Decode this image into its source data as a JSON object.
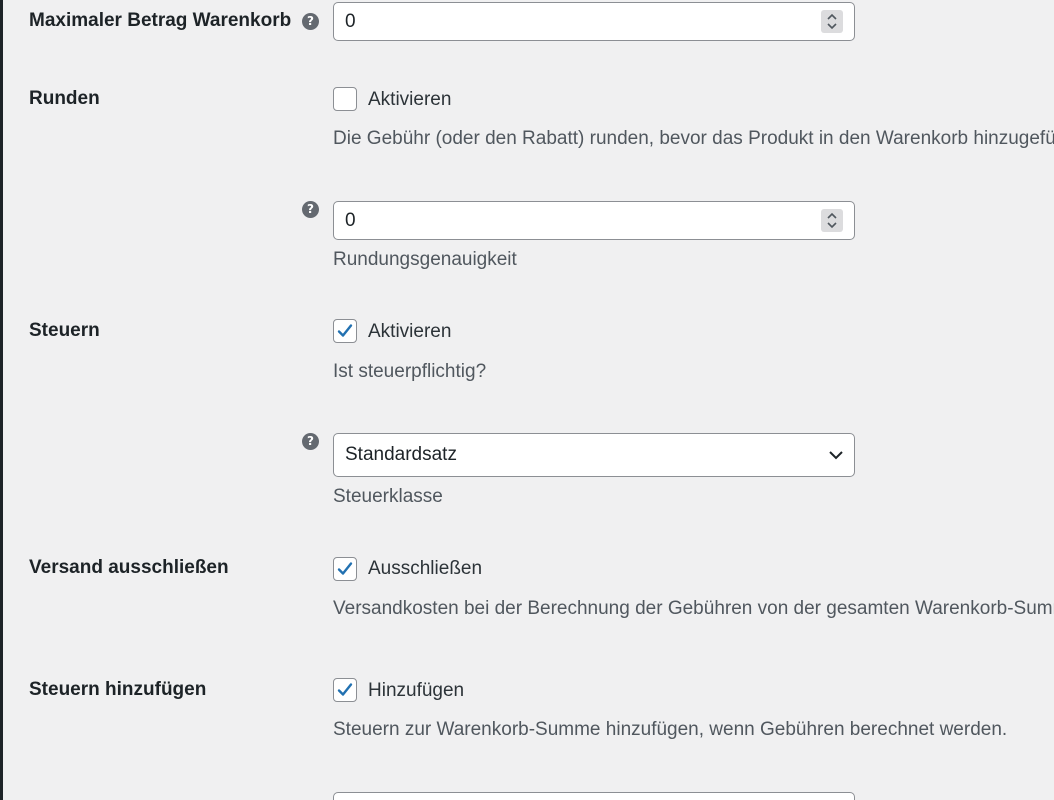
{
  "fields": {
    "max_cart": {
      "label": "Maximaler Betrag Warenkorb",
      "value": "0"
    },
    "round": {
      "label": "Runden",
      "checkbox_label": "Aktivieren",
      "checked": false,
      "description": "Die Gebühr (oder den Rabatt) runden, bevor das Produkt in den Warenkorb hinzugefü"
    },
    "rounding_precision": {
      "value": "0",
      "description": "Rundungsgenauigkeit"
    },
    "taxes": {
      "label": "Steuern",
      "checkbox_label": "Aktivieren",
      "checked": true,
      "description": "Ist steuerpflichtig?"
    },
    "tax_class": {
      "selected": "Standardsatz",
      "description": "Steuerklasse"
    },
    "exclude_shipping": {
      "label": "Versand ausschließen",
      "checkbox_label": "Ausschließen",
      "checked": true,
      "description": "Versandkosten bei der Berechnung der Gebühren von der gesamten Warenkorb-Summ"
    },
    "add_taxes": {
      "label": "Steuern hinzufügen",
      "checkbox_label": "Hinzufügen",
      "checked": true,
      "description": "Steuern zur Warenkorb-Summe hinzufügen, wenn Gebühren berechnet werden."
    }
  },
  "help_icon_glyph": "?",
  "colors": {
    "checkmark": "#2271b1",
    "background": "#f0f0f1",
    "border": "#8c8f94"
  }
}
